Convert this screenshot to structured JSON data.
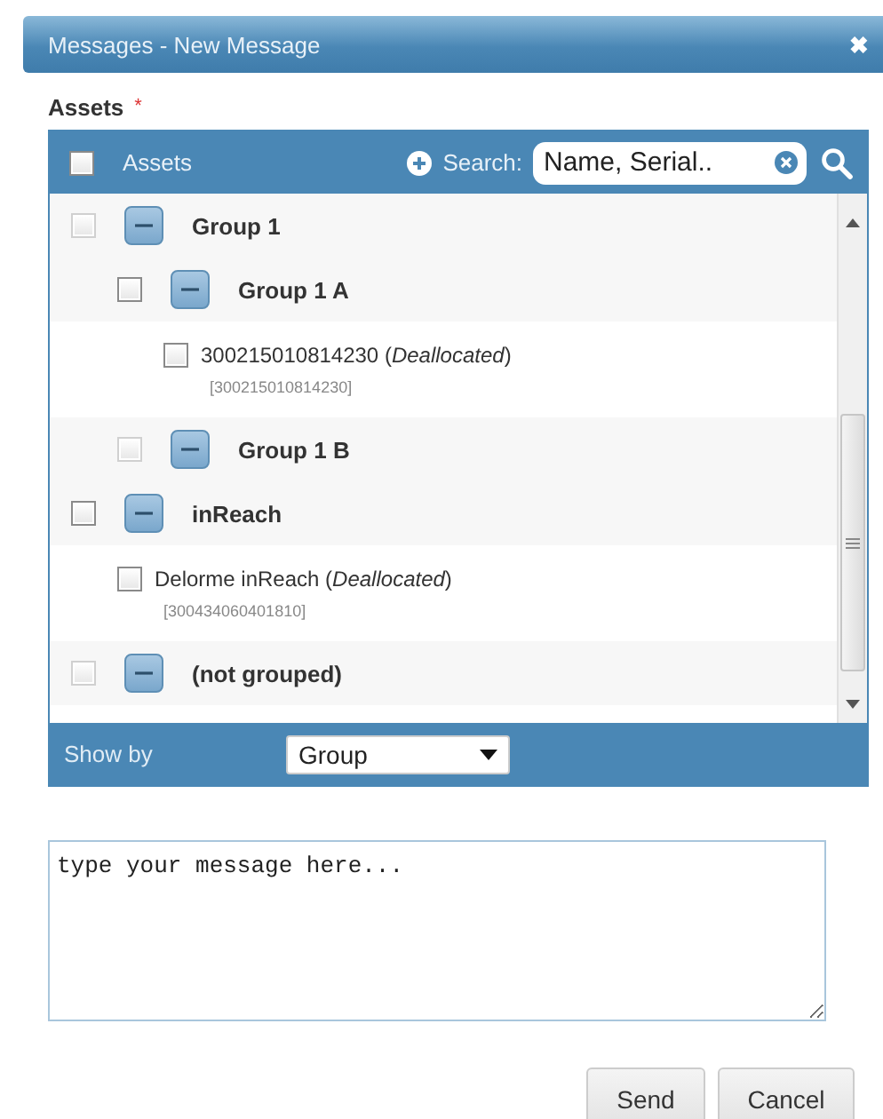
{
  "window": {
    "title": "Messages - New Message",
    "close": "✖"
  },
  "assets_label": {
    "text": "Assets",
    "required": "*"
  },
  "panel": {
    "header_checkbox": {
      "checked": false
    },
    "header_label": "Assets",
    "search_label": "Search:",
    "search": {
      "placeholder": "Name, Serial.."
    }
  },
  "tree": [
    {
      "kind": "group",
      "label": "Group 1",
      "checked": false,
      "disabled": true,
      "expanded": true,
      "children": [
        {
          "kind": "group",
          "label": "Group 1 A",
          "checked": false,
          "disabled": false,
          "expanded": true,
          "children": [
            {
              "kind": "asset",
              "label": "300215010814230 (*Deallocated*)",
              "serial": "[300215010814230]",
              "checked": false
            }
          ]
        },
        {
          "kind": "group",
          "label": "Group 1 B",
          "checked": false,
          "disabled": true,
          "expanded": true
        }
      ]
    },
    {
      "kind": "group",
      "label": "inReach",
      "checked": false,
      "disabled": false,
      "expanded": true,
      "children": [
        {
          "kind": "asset",
          "label": "Delorme inReach (*Deallocated*)",
          "serial": "[300434060401810]",
          "checked": false
        }
      ]
    },
    {
      "kind": "group",
      "label": "(not grouped)",
      "checked": false,
      "disabled": true,
      "expanded": true
    }
  ],
  "show_by": {
    "label": "Show by",
    "value": "Group"
  },
  "message": {
    "placeholder": "type your message here..."
  },
  "buttons": [
    "Send",
    "Cancel"
  ]
}
